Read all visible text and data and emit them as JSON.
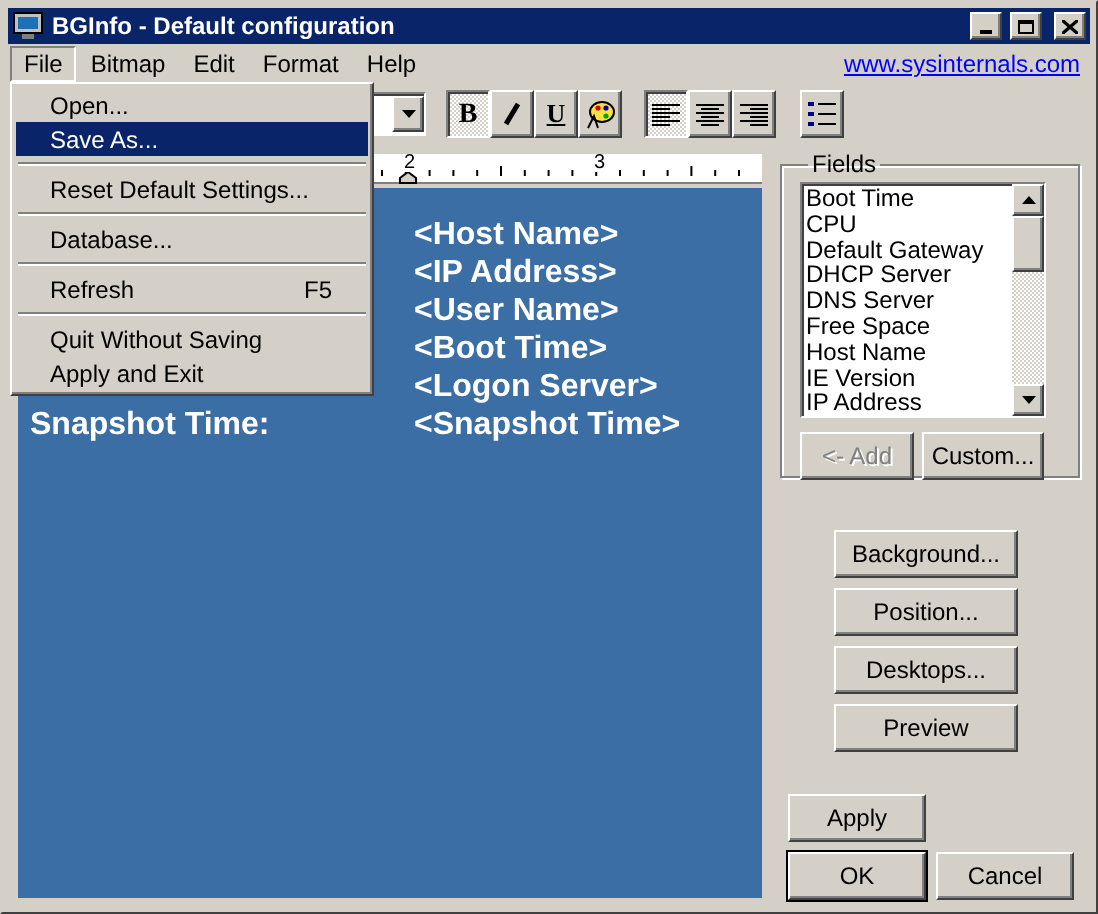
{
  "window": {
    "title": "BGInfo - Default configuration"
  },
  "menu_bar": [
    {
      "label": "File",
      "selected": true
    },
    {
      "label": "Bitmap",
      "selected": false
    },
    {
      "label": "Edit",
      "selected": false
    },
    {
      "label": "Format",
      "selected": false
    },
    {
      "label": "Help",
      "selected": false
    }
  ],
  "link": "www.sysinternals.com",
  "file_menu": [
    {
      "kind": "item",
      "label": "Open...",
      "selected": false
    },
    {
      "kind": "item",
      "label": "Save As...",
      "selected": true
    },
    {
      "kind": "separator"
    },
    {
      "kind": "item",
      "label": "Reset Default Settings...",
      "selected": false
    },
    {
      "kind": "separator"
    },
    {
      "kind": "item",
      "label": "Database...",
      "selected": false
    },
    {
      "kind": "separator"
    },
    {
      "kind": "item",
      "label": "Refresh",
      "shortcut": "F5",
      "selected": false
    },
    {
      "kind": "separator"
    },
    {
      "kind": "item",
      "label": "Quit Without Saving",
      "selected": false
    },
    {
      "kind": "item",
      "label": "Apply and Exit",
      "selected": false
    }
  ],
  "format_buttons": [
    {
      "kind": "bold",
      "label": "B",
      "pressed": true
    },
    {
      "kind": "italic",
      "pressed": false
    },
    {
      "kind": "underline",
      "label": "U",
      "pressed": false
    },
    {
      "kind": "color",
      "pressed": false
    }
  ],
  "align_buttons": [
    {
      "kind": "left",
      "selected": true
    },
    {
      "kind": "center",
      "selected": false
    },
    {
      "kind": "right",
      "selected": false
    }
  ],
  "ruler": {
    "marks": [
      "2",
      "3"
    ]
  },
  "editor": {
    "rows": [
      {
        "value": "<Host Name>"
      },
      {
        "value": "<IP Address>"
      },
      {
        "value": "<User Name>"
      },
      {
        "value": "<Boot Time>"
      },
      {
        "value": "<Logon Server>"
      },
      {
        "label": "Snapshot Time:",
        "value": "<Snapshot Time>"
      }
    ]
  },
  "fields": {
    "title": "Fields",
    "items": [
      "Boot Time",
      "CPU",
      "Default Gateway",
      "DHCP Server",
      "DNS Server",
      "Free Space",
      "Host Name",
      "IE Version",
      "IP Address"
    ],
    "add_button": {
      "label": "<- Add",
      "disabled": true
    },
    "custom_button": {
      "label": "Custom...",
      "disabled": false
    }
  },
  "side_buttons": [
    "Background...",
    "Position...",
    "Desktops...",
    "Preview"
  ],
  "dialog_buttons": [
    {
      "label": "Apply",
      "default": false
    },
    {
      "label": "OK",
      "default": true
    },
    {
      "label": "Cancel",
      "default": false
    }
  ]
}
